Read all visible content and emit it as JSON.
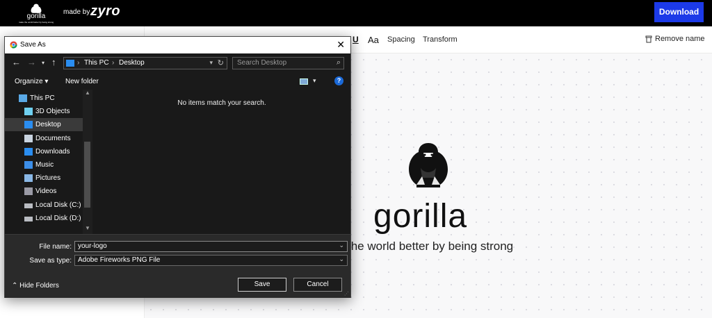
{
  "topbar": {
    "brand_name": "gorilla",
    "brand_tagline": "make the world better by being strong",
    "made_by": "made by",
    "made_by_brand": "zyro",
    "download_label": "Download",
    "accent": "#1c3ae8"
  },
  "toolbar": {
    "underline_label": "U",
    "font_size_label": "Aa",
    "spacing_label": "Spacing",
    "transform_label": "Transform",
    "remove_name_label": "Remove name"
  },
  "logo": {
    "name": "gorilla",
    "tagline": "the world better by being strong"
  },
  "dialog": {
    "title": "Save As",
    "address": {
      "crumbs": [
        "This PC",
        "Desktop"
      ]
    },
    "search_placeholder": "Search Desktop",
    "organize_label": "Organize",
    "new_folder_label": "New folder",
    "empty_message": "No items match your search.",
    "tree": [
      {
        "label": "This PC",
        "icon": "computer-icon",
        "selected": false
      },
      {
        "label": "3D Objects",
        "icon": "cube-icon",
        "selected": false
      },
      {
        "label": "Desktop",
        "icon": "desktop-icon",
        "selected": true
      },
      {
        "label": "Documents",
        "icon": "document-icon",
        "selected": false
      },
      {
        "label": "Downloads",
        "icon": "download-icon",
        "selected": false
      },
      {
        "label": "Music",
        "icon": "music-icon",
        "selected": false
      },
      {
        "label": "Pictures",
        "icon": "pictures-icon",
        "selected": false
      },
      {
        "label": "Videos",
        "icon": "videos-icon",
        "selected": false
      },
      {
        "label": "Local Disk (C:)",
        "icon": "disk-icon",
        "selected": false
      },
      {
        "label": "Local Disk (D:)",
        "icon": "disk-icon",
        "selected": false
      }
    ],
    "file_name_label": "File name:",
    "file_name_value": "your-logo",
    "save_type_label": "Save as type:",
    "save_type_value": "Adobe Fireworks PNG File",
    "hide_folders_label": "Hide Folders",
    "save_label": "Save",
    "cancel_label": "Cancel"
  }
}
